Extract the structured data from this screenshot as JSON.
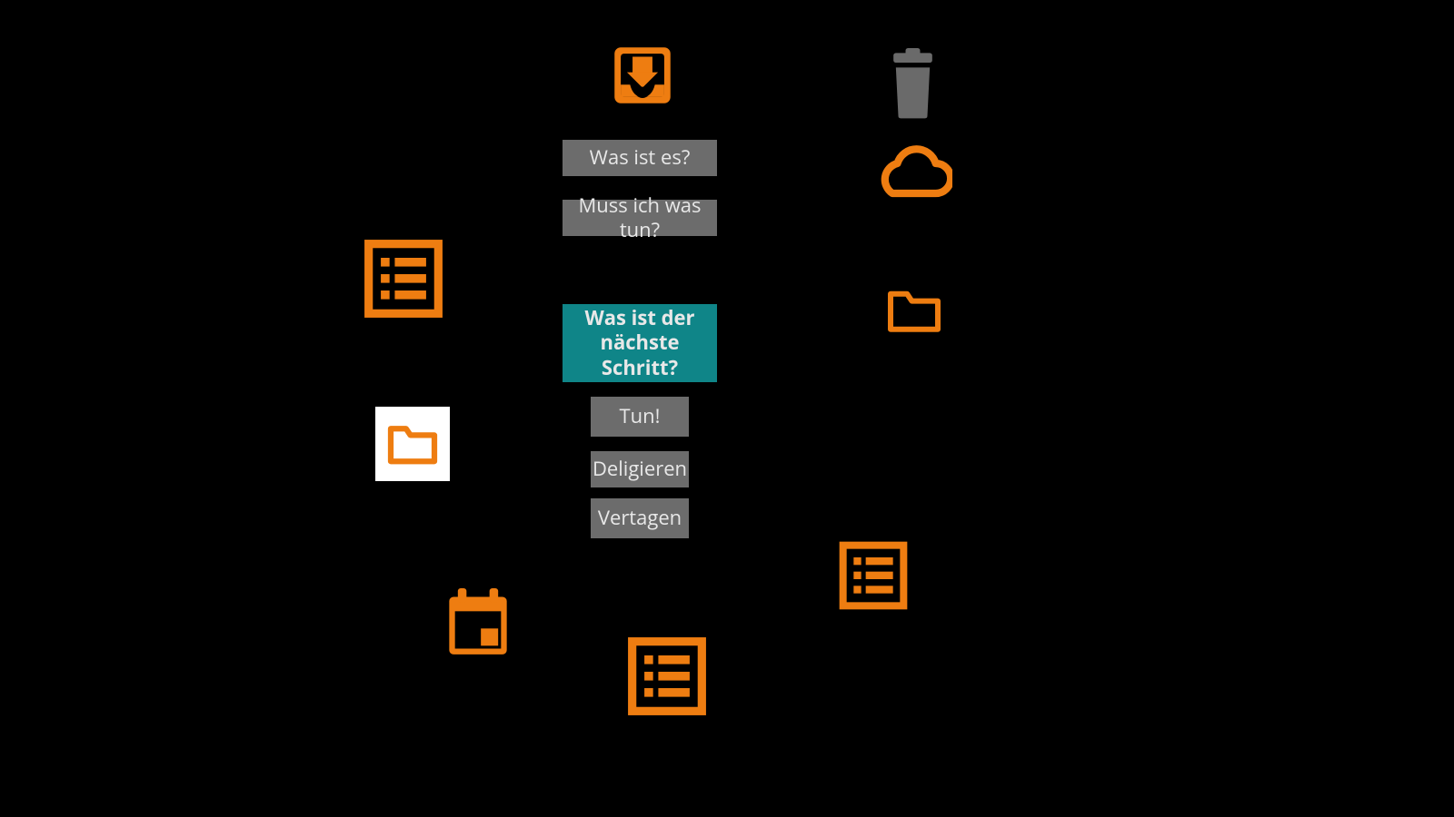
{
  "colors": {
    "accent": "#ee7d11",
    "teal": "#0f8588",
    "gray": "#6c6c6c",
    "dim": "#6a6a6a"
  },
  "center": {
    "q1": "Was ist es?",
    "q2": "Muss ich was tun?",
    "next_step": "Was ist der nächste Schritt?",
    "do_it": "Tun!",
    "delegate": "Deligieren",
    "postpone": "Vertagen"
  },
  "icons": {
    "inbox": "inbox-icon",
    "trash": "trash-icon",
    "cloud": "cloud-icon",
    "folder": "folder-icon",
    "list_left": "list-icon",
    "project_box": "folder-icon",
    "calendar": "calendar-icon",
    "list_bottom": "list-icon",
    "list_right": "list-icon"
  }
}
